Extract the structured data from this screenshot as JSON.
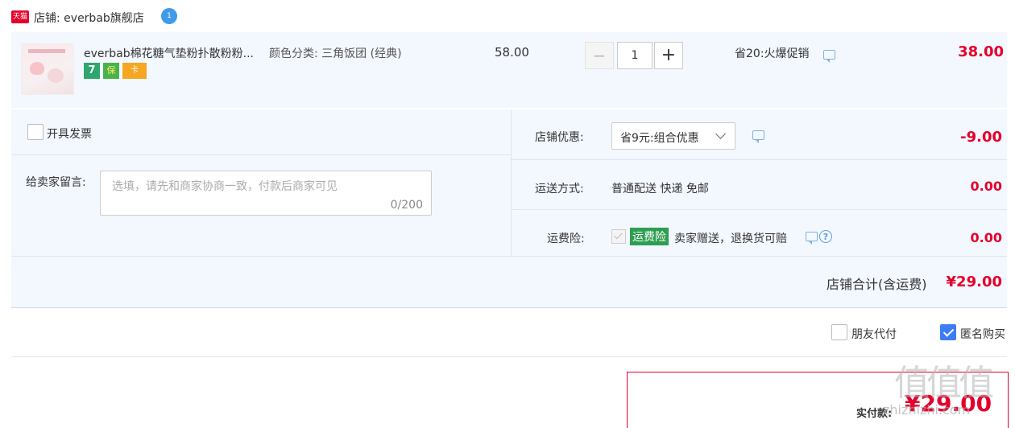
{
  "shop": {
    "tmall_badge": "天猫",
    "label": "店铺: everbab旗舰店",
    "chat_badge": "1"
  },
  "item": {
    "title": "everbab棉花糖气垫粉扑散粉粉...",
    "spec": "颜色分类: 三角饭团 (经典)",
    "unit_price": "58.00",
    "quantity": "1",
    "minus": "−",
    "plus": "+",
    "promo": "省20:火爆促销",
    "subtotal": "38.00",
    "service_badges": [
      "7",
      "保",
      "卡"
    ]
  },
  "invoice": {
    "label": "开具发票",
    "checked": false
  },
  "message": {
    "label": "给卖家留言:",
    "placeholder": "选填，请先和商家协商一致，付款后商家可见",
    "counter": "0/200"
  },
  "shop_discount": {
    "label": "店铺优惠:",
    "selected": "省9元:组合优惠",
    "amount": "-9.00"
  },
  "shipping": {
    "label": "运送方式:",
    "value": "普通配送 快递 免邮",
    "amount": "0.00"
  },
  "insurance": {
    "label": "运费险:",
    "tag": "运费险",
    "desc": "卖家赠送，退换货可赔",
    "amount": "0.00"
  },
  "total": {
    "label": "店铺合计(含运费)",
    "amount": "¥29.00"
  },
  "options": {
    "friend_pay": "朋友代付",
    "anonymous": "匿名购买"
  },
  "payment": {
    "label": "实付款:",
    "amount": "¥29.00"
  },
  "watermark": {
    "main": "值值值",
    "sub": "zhizhizhi.com"
  },
  "colors": {
    "price_red": "#e4002b",
    "panel_bg": "#f3f8fe",
    "checkbox_blue": "#3c7df5",
    "tag_green": "#2e9e50"
  }
}
